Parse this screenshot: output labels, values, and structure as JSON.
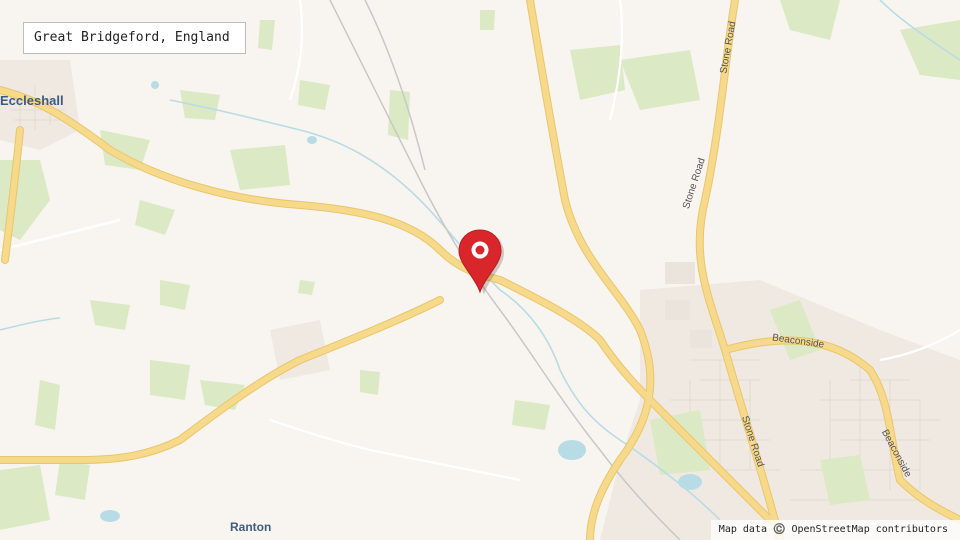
{
  "search": {
    "location_text": "Great Bridgeford, England"
  },
  "map": {
    "places": {
      "eccleshall": "Eccleshall",
      "ranton": "Ranton"
    },
    "roads": {
      "stone_road": "Stone Road",
      "beaconside": "Beaconside"
    },
    "attribution": "Map data ©️ OpenStreetMap contributors",
    "marker_icon": "location-pin-icon"
  },
  "colors": {
    "land": "#f8f4ef",
    "green": "#dbe9c5",
    "water": "#b8dce6",
    "road_major": "#f6d98a",
    "road_minor": "#ffffff",
    "urban": "#efe9e2",
    "marker": "#d9262b",
    "label": "#3f5b80"
  }
}
